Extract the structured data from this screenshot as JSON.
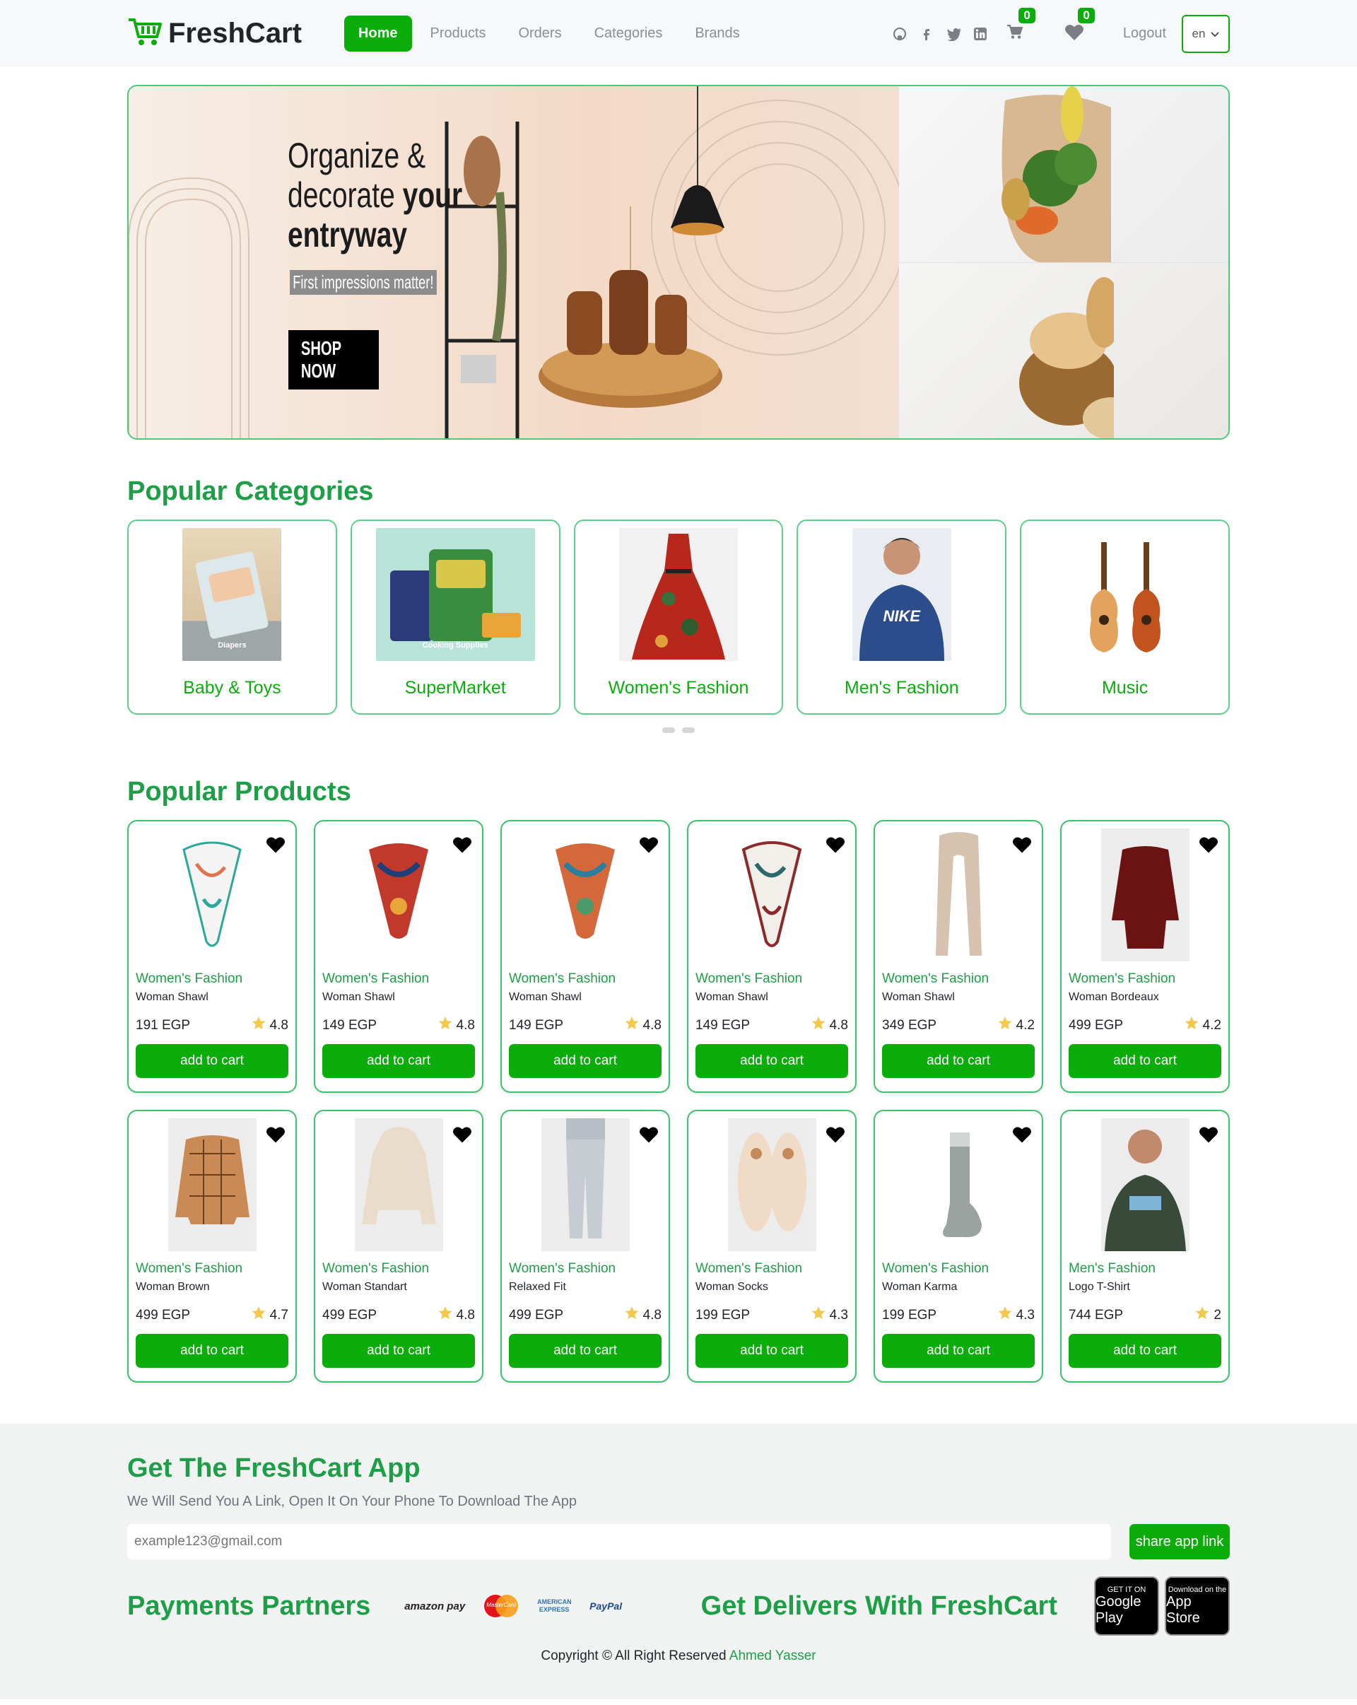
{
  "brand": {
    "name": "FreshCart"
  },
  "nav": {
    "links": [
      "Home",
      "Products",
      "Orders",
      "Categories",
      "Brands"
    ],
    "cart_count": "0",
    "wishlist_count": "0",
    "logout": "Logout",
    "language": "en"
  },
  "hero": {
    "heading_line1": "Organize &",
    "heading_line2a": "decorate",
    "heading_line2b": "your",
    "heading_line3": "entryway",
    "subheading": "First impressions matter!",
    "cta": "SHOP NOW"
  },
  "categories": {
    "title": "Popular Categories",
    "items": [
      {
        "name": "Baby & Toys",
        "image_caption": "Diapers"
      },
      {
        "name": "SuperMarket",
        "image_caption": "Cooking Supplies"
      },
      {
        "name": "Women's Fashion",
        "image_caption": ""
      },
      {
        "name": "Men's Fashion",
        "image_caption": "NIKE"
      },
      {
        "name": "Music",
        "image_caption": ""
      }
    ]
  },
  "products": {
    "title": "Popular Products",
    "add_label": "add to cart",
    "items": [
      {
        "category": "Women's Fashion",
        "name": "Woman Shawl",
        "price": "191 EGP",
        "rating": "4.8"
      },
      {
        "category": "Women's Fashion",
        "name": "Woman Shawl",
        "price": "149 EGP",
        "rating": "4.8"
      },
      {
        "category": "Women's Fashion",
        "name": "Woman Shawl",
        "price": "149 EGP",
        "rating": "4.8"
      },
      {
        "category": "Women's Fashion",
        "name": "Woman Shawl",
        "price": "149 EGP",
        "rating": "4.8"
      },
      {
        "category": "Women's Fashion",
        "name": "Woman Shawl",
        "price": "349 EGP",
        "rating": "4.2"
      },
      {
        "category": "Women's Fashion",
        "name": "Woman Bordeaux",
        "price": "499 EGP",
        "rating": "4.2"
      },
      {
        "category": "Women's Fashion",
        "name": "Woman Brown",
        "price": "499 EGP",
        "rating": "4.7"
      },
      {
        "category": "Women's Fashion",
        "name": "Woman Standart",
        "price": "499 EGP",
        "rating": "4.8"
      },
      {
        "category": "Women's Fashion",
        "name": "Relaxed Fit",
        "price": "499 EGP",
        "rating": "4.8"
      },
      {
        "category": "Women's Fashion",
        "name": "Woman Socks",
        "price": "199 EGP",
        "rating": "4.3"
      },
      {
        "category": "Women's Fashion",
        "name": "Woman Karma",
        "price": "199 EGP",
        "rating": "4.3"
      },
      {
        "category": "Men's Fashion",
        "name": "Logo T-Shirt",
        "price": "744 EGP",
        "rating": "2"
      }
    ]
  },
  "footer": {
    "app_title": "Get The FreshCart App",
    "app_subtitle": "We Will Send You A Link, Open It On Your Phone To Download The App",
    "email_placeholder": "example123@gmail.com",
    "share_label": "share app link",
    "partners_title": "Payments Partners",
    "payment_logos": [
      "amazon pay",
      "MasterCard",
      "AMERICAN EXPRESS",
      "PayPal"
    ],
    "deliver_title": "Get Delivers With FreshCart",
    "stores": [
      {
        "small": "GET IT ON",
        "name": "Google Play"
      },
      {
        "small": "Download on the",
        "name": "App Store"
      }
    ],
    "copyright_text": "Copyright © All Right Reserved",
    "copyright_author": "Ahmed Yasser"
  },
  "colors": {
    "accent": "#0aad0a",
    "heading": "#1e9e47",
    "border": "#4cc97a"
  }
}
